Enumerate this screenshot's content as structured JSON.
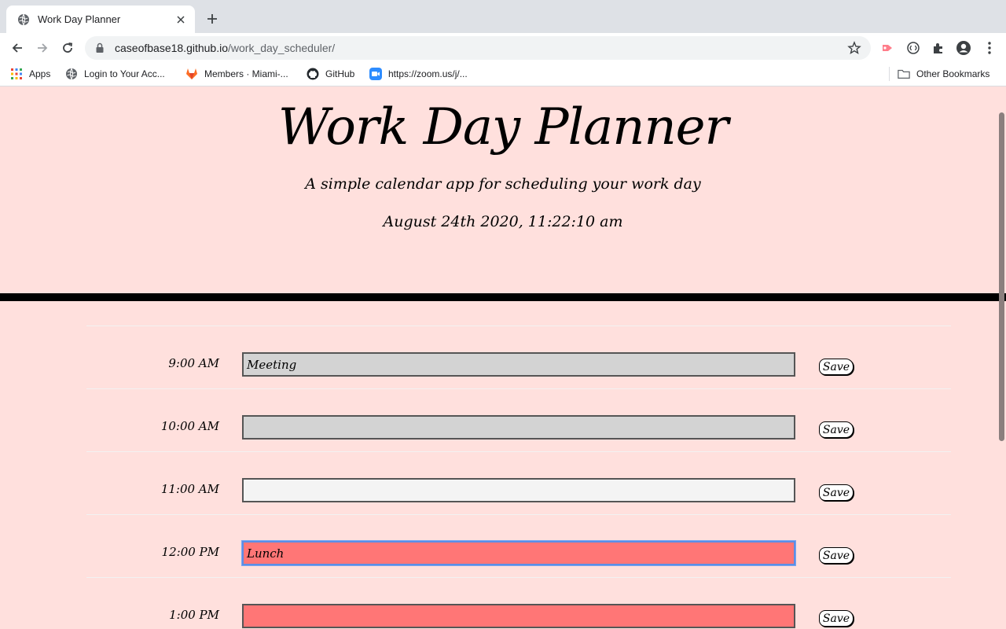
{
  "browser": {
    "tab_title": "Work Day Planner",
    "url_host": "caseofbase18.github.io",
    "url_path": "/work_day_scheduler/",
    "bookmarks": [
      {
        "label": "Apps"
      },
      {
        "label": "Login to Your Acc..."
      },
      {
        "label": "Members · Miami-..."
      },
      {
        "label": "GitHub"
      },
      {
        "label": "https://zoom.us/j/..."
      }
    ],
    "other_bookmarks": "Other Bookmarks"
  },
  "header": {
    "title": "Work Day Planner",
    "subtitle": "A simple calendar app for scheduling your work day",
    "current_day": "August 24th 2020, 11:22:10 am"
  },
  "rows": [
    {
      "hour": "9:00 AM",
      "text": "Meeting",
      "status": "past",
      "save": "Save"
    },
    {
      "hour": "10:00 AM",
      "text": "",
      "status": "past",
      "save": "Save"
    },
    {
      "hour": "11:00 AM",
      "text": "",
      "status": "present",
      "save": "Save"
    },
    {
      "hour": "12:00 PM",
      "text": "Lunch",
      "status": "future",
      "save": "Save"
    },
    {
      "hour": "1:00 PM",
      "text": "",
      "status": "future",
      "save": "Save"
    }
  ],
  "colors": {
    "background": "#ffe0dd",
    "past": "#d3d3d3",
    "present": "#f4f4f4",
    "future": "#ff7676"
  },
  "icons": [
    "globe-icon",
    "close-icon",
    "plus-icon",
    "back-arrow-icon",
    "forward-arrow-icon",
    "reload-icon",
    "lock-icon",
    "star-icon",
    "extension-icon",
    "profile-icon",
    "more-icon",
    "apps-grid-icon",
    "gitlab-icon",
    "github-icon",
    "zoom-icon",
    "folder-icon"
  ]
}
